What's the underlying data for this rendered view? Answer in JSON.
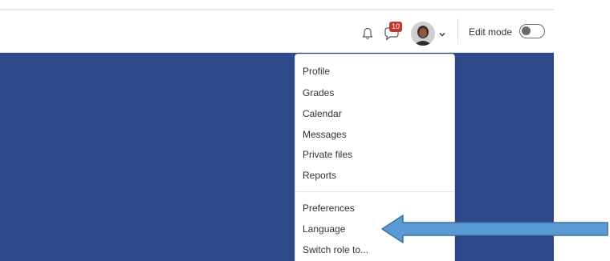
{
  "navbar": {
    "notifications_icon": "bell-icon",
    "messages_icon": "chat-bubble-icon",
    "messages_badge": "10",
    "avatar_icon": "user-avatar",
    "avatar_caret_icon": "chevron-down-icon",
    "edit_mode_label": "Edit mode",
    "edit_mode_on": false
  },
  "user_menu": {
    "items_group1": [
      "Profile",
      "Grades",
      "Calendar",
      "Messages",
      "Private files",
      "Reports"
    ],
    "items_group2": [
      "Preferences",
      "Language",
      "Switch role to..."
    ]
  },
  "annotation": {
    "arrow_icon": "left-arrow-icon",
    "arrow_color": "#5b9bd5"
  },
  "colors": {
    "banner": "#2e4a8a",
    "badge": "#c0392b"
  }
}
